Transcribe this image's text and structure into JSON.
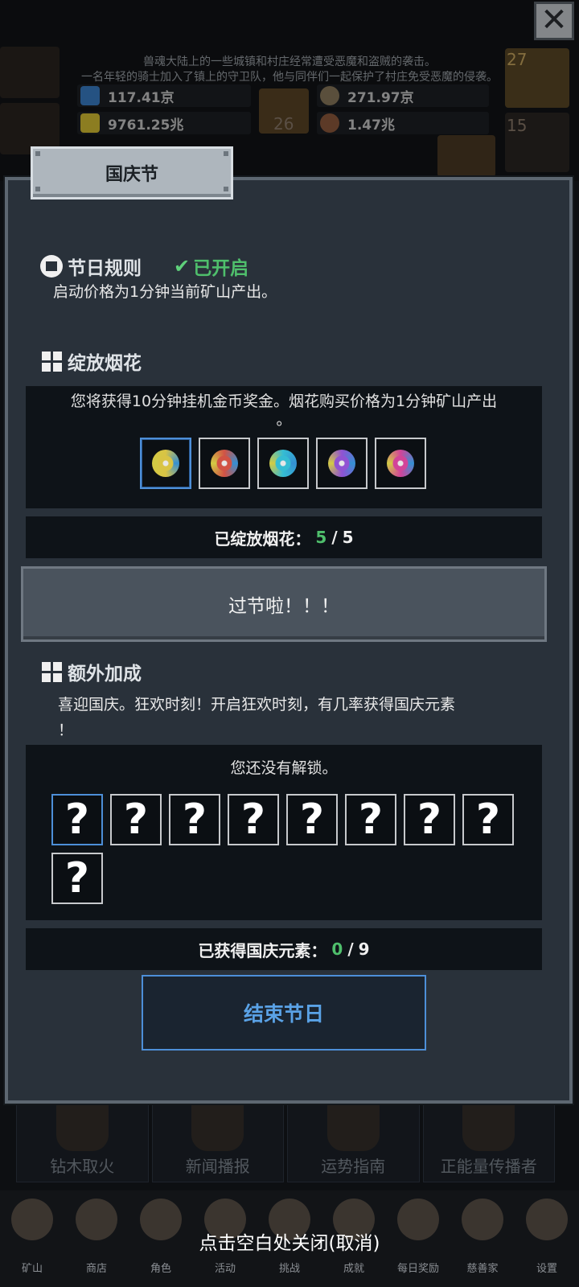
{
  "background": {
    "story_line1": "兽魂大陆上的一些城镇和村庄经常遭受恶魔和盗贼的袭击。",
    "story_line2": "一名年轻的骑士加入了镇上的守卫队，他与同伴们一起保护了村庄免受恶魔的侵袭。",
    "resources": [
      {
        "value": "117.41京",
        "icon": "potion-blue-icon"
      },
      {
        "value": "9761.25兆",
        "icon": "potion-yellow-icon"
      },
      {
        "value": "271.97京",
        "icon": "ore-icon"
      },
      {
        "value": "1.47兆",
        "icon": "meat-icon"
      }
    ],
    "side_counts": {
      "potion": "27",
      "chest": "15",
      "book": "26"
    },
    "bottom_cards": [
      "钻木取火",
      "新闻播报",
      "运势指南",
      "正能量传播者"
    ]
  },
  "nav": {
    "items": [
      {
        "label": "矿山",
        "icon": "lantern-icon"
      },
      {
        "label": "商店",
        "icon": "ore-icon"
      },
      {
        "label": "角色",
        "icon": "skull-icon"
      },
      {
        "label": "活动",
        "icon": "scroll-icon"
      },
      {
        "label": "挑战",
        "icon": "map-icon"
      },
      {
        "label": "成就",
        "icon": "key-icon"
      },
      {
        "label": "每日奖励",
        "icon": "envelope-icon"
      },
      {
        "label": "慈善家",
        "icon": "bread-icon"
      },
      {
        "label": "设置",
        "icon": "gear-icon"
      }
    ],
    "close_hint": "点击空白处关闭(取消)"
  },
  "modal": {
    "title": "国庆节",
    "close_label": "✕",
    "rules": {
      "heading": "节日规则",
      "status": "已开启",
      "description": "启动价格为1分钟当前矿山产出。"
    },
    "fireworks": {
      "heading": "绽放烟花",
      "description_line1": "您将获得10分钟挂机金币奖金。烟花购买价格为1分钟矿山产出",
      "description_line2": "。",
      "count_label": "已绽放烟花：",
      "count_current": "5",
      "count_sep": "/",
      "count_total": "5",
      "colors": [
        "#f0d84a",
        "#e85a4a",
        "#3ad0e8",
        "#a05ae8",
        "#e84aa8"
      ]
    },
    "party_button": "过节啦！！！",
    "bonus": {
      "heading": "额外加成",
      "description_line1": "喜迎国庆。狂欢时刻！开启狂欢时刻，有几率获得国庆元素",
      "description_line2": "！",
      "locked_text": "您还没有解锁。",
      "slot_symbol": "?",
      "count_label": "已获得国庆元素：",
      "count_current": "0",
      "count_sep": "/",
      "count_total": "9"
    },
    "end_button": "结束节日"
  }
}
